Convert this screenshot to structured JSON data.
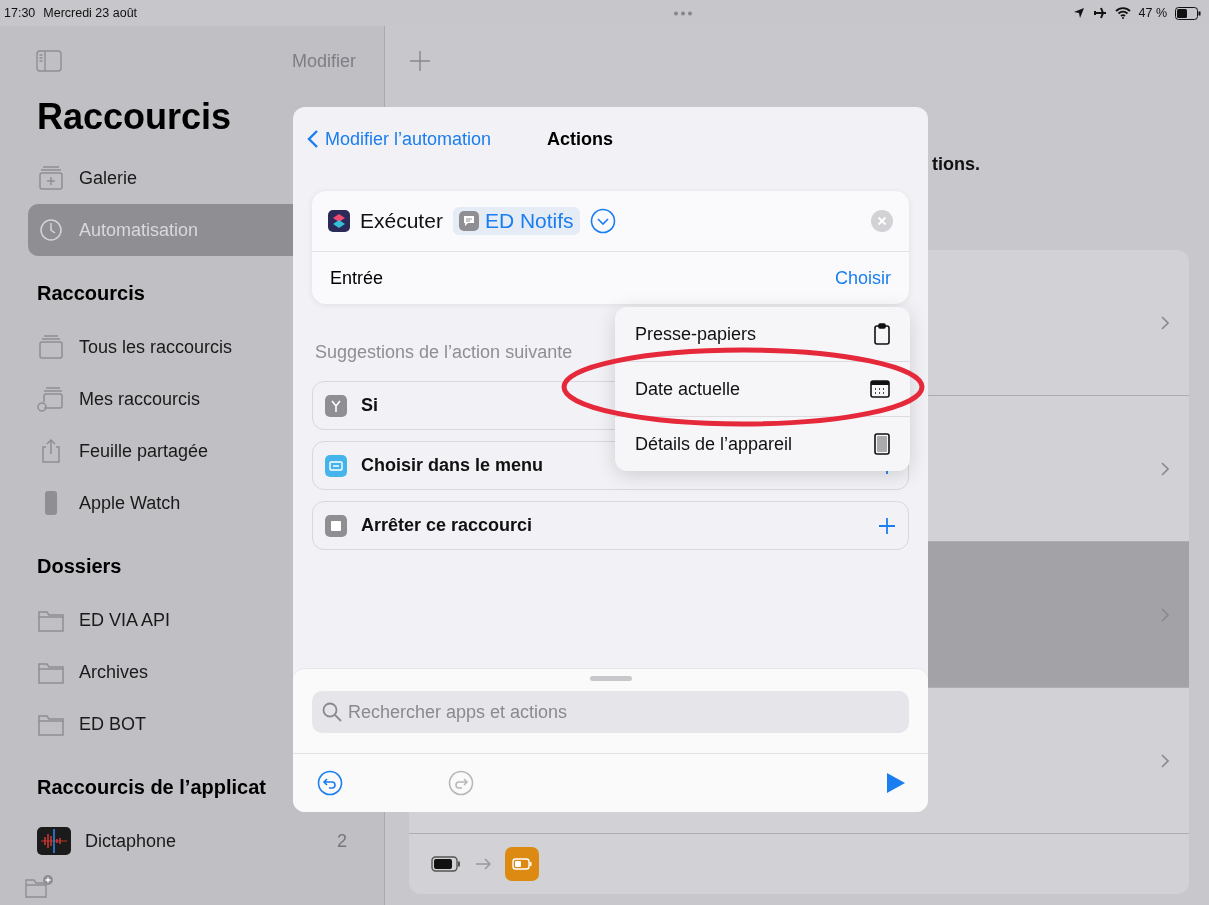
{
  "status_bar": {
    "time": "17:30",
    "date": "Mercredi 23 août",
    "battery": "47 %"
  },
  "sidebar": {
    "edit_button": "Modifier",
    "title": "Raccourcis",
    "top_items": [
      {
        "label": "Galerie",
        "kind": "gallery",
        "selected": false
      },
      {
        "label": "Automatisation",
        "kind": "automation",
        "selected": true
      }
    ],
    "sections": [
      {
        "title": "Raccourcis",
        "items": [
          {
            "label": "Tous les raccourcis",
            "kind": "stack"
          },
          {
            "label": "Mes raccourcis",
            "kind": "personal"
          },
          {
            "label": "Feuille partagée",
            "kind": "share"
          },
          {
            "label": "Apple Watch",
            "kind": "watch"
          }
        ]
      },
      {
        "title": "Dossiers",
        "items": [
          {
            "label": "ED VIA API",
            "kind": "folder"
          },
          {
            "label": "Archives",
            "kind": "folder"
          },
          {
            "label": "ED BOT",
            "kind": "folder"
          }
        ]
      },
      {
        "title": "Raccourcis de l’applicat",
        "items": [
          {
            "label": "Dictaphone",
            "kind": "app",
            "count": "2"
          }
        ]
      }
    ]
  },
  "main": {
    "partial_text": "tions.",
    "rows": [
      {
        "selected": false
      },
      {
        "selected": false
      },
      {
        "selected": true
      },
      {
        "selected": false
      }
    ]
  },
  "modal": {
    "back": "Modifier l’automation",
    "title": "Actions",
    "action": {
      "verb": "Exécuter",
      "parameter": "ED Notifs",
      "input_label": "Entrée",
      "input_button": "Choisir"
    },
    "suggestions_title": "Suggestions de l’action suivante",
    "suggestions": [
      {
        "label": "Si",
        "kind": "if"
      },
      {
        "label": "Choisir dans le menu",
        "kind": "menu"
      },
      {
        "label": "Arrêter ce raccourci",
        "kind": "stop"
      }
    ],
    "search": {
      "placeholder": "Rechercher apps et actions"
    }
  },
  "menu": {
    "items": [
      {
        "label": "Presse-papiers",
        "kind": "clipboard",
        "circled": false
      },
      {
        "label": "Date actuelle",
        "kind": "calendar",
        "circled": true
      },
      {
        "label": "Détails de l’appareil",
        "kind": "device",
        "circled": false
      }
    ]
  }
}
